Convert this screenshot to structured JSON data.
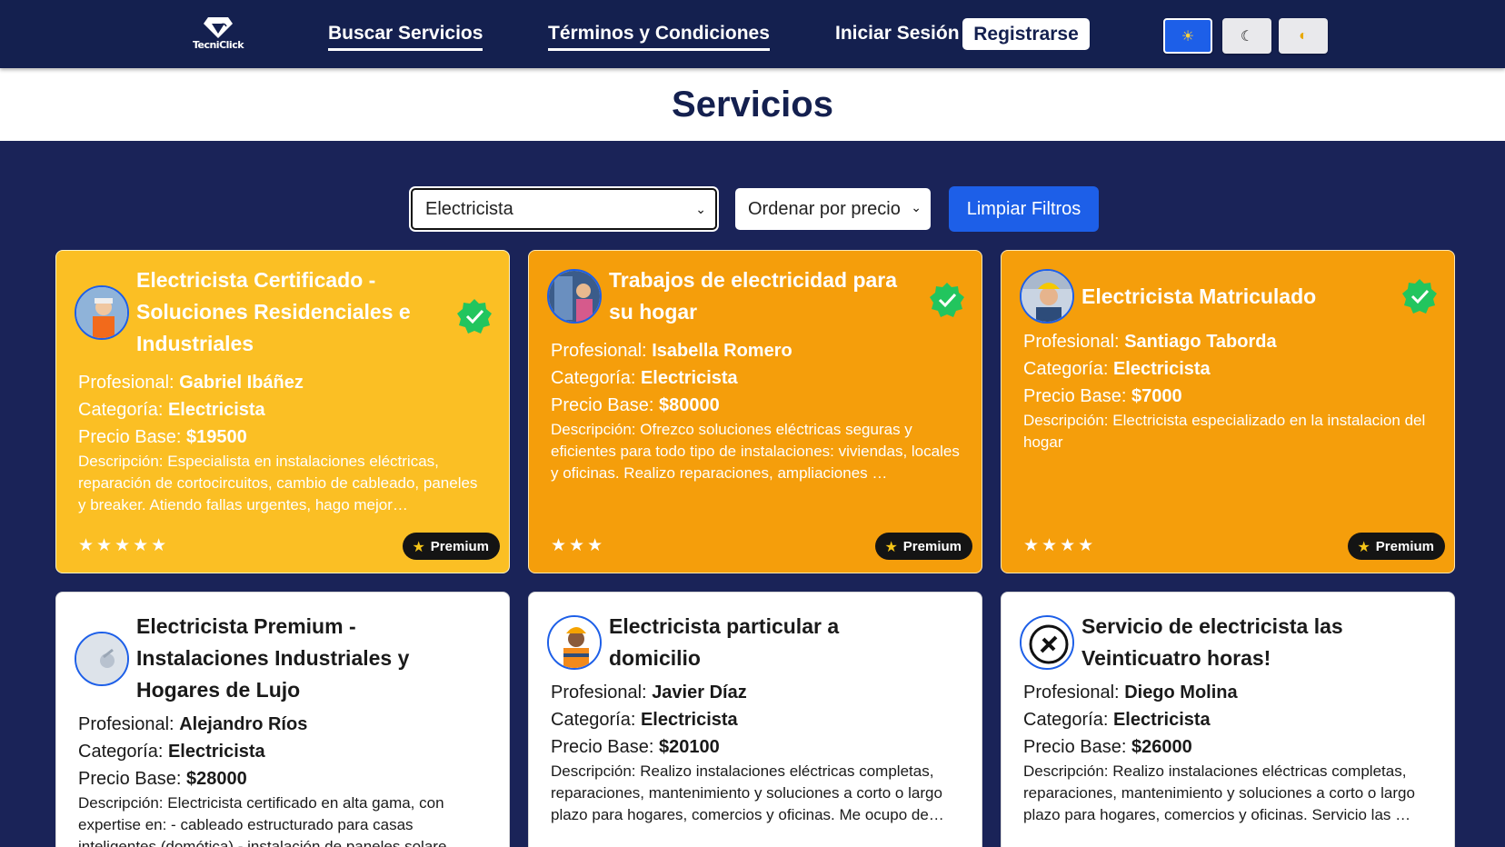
{
  "header": {
    "logo_text": "TecniClick",
    "nav": [
      {
        "label": "Buscar Servicios"
      },
      {
        "label": "Términos y Condiciones"
      }
    ],
    "login_label": "Iniciar Sesión",
    "register_label": "Registrarse",
    "theme_buttons": [
      {
        "icon": "sun-icon",
        "glyph": "☀",
        "active": true
      },
      {
        "icon": "moon-icon",
        "glyph": "☾",
        "active": false
      },
      {
        "icon": "moon-half-icon",
        "glyph": "◐",
        "active": false
      }
    ]
  },
  "page": {
    "title": "Servicios"
  },
  "filters": {
    "category_selected": "Electricista",
    "order_selected": "Ordenar por precio",
    "clear_label": "Limpiar Filtros"
  },
  "labels": {
    "professional": "Profesional:",
    "category": "Categoría:",
    "price": "Precio Base:",
    "description": "Descripción:",
    "premium": "Premium"
  },
  "colors": {
    "nav_bg": "#14204f",
    "body_bg": "#1a2358",
    "accent": "#1d5fe8",
    "premium_yellow": "#fbbf24",
    "premium_orange": "#f59e0b",
    "verified_green": "#22c55e"
  },
  "cards": [
    {
      "title": "Electricista Certificado - Soluciones Residenciales e Industriales",
      "professional": "Gabriel Ibáñez",
      "category": "Electricista",
      "price": "$19500",
      "description": "Especialista en instalaciones eléctricas, reparación de cortocircuitos, cambio de cableado, paneles y breaker. Atiendo fallas urgentes, hago mejor…",
      "rating": 5,
      "stars": "★★★★★",
      "premium": true,
      "verified": true
    },
    {
      "title": "Trabajos de electricidad para su hogar",
      "professional": "Isabella Romero",
      "category": "Electricista",
      "price": "$80000",
      "description": "Ofrezco soluciones eléctricas seguras y eficientes para todo tipo de instalaciones: viviendas, locales y oficinas. Realizo reparaciones, ampliaciones …",
      "rating": 3,
      "stars": "★★★",
      "premium": true,
      "verified": true
    },
    {
      "title": "Electricista Matriculado",
      "professional": "Santiago Taborda",
      "category": "Electricista",
      "price": "$7000",
      "description": "Electricista especializado en la instalacion del hogar",
      "rating": 4,
      "stars": "★★★★",
      "premium": true,
      "verified": true
    },
    {
      "title": "Electricista Premium - Instalaciones Industriales y Hogares de Lujo",
      "professional": "Alejandro Ríos",
      "category": "Electricista",
      "price": "$28000",
      "description": "Electricista certificado en alta gama, con expertise en: - cableado estructurado para casas inteligentes (domótica) - instalación de paneles solare…",
      "premium": false,
      "verified": false
    },
    {
      "title": "Electricista particular a domicilio",
      "professional": "Javier Díaz",
      "category": "Electricista",
      "price": "$20100",
      "description": "Realizo instalaciones eléctricas completas, reparaciones, mantenimiento y soluciones a corto o largo plazo para hogares, comercios y oficinas. Me ocupo de…",
      "premium": false,
      "verified": false
    },
    {
      "title": "Servicio de electricista las Veinticuatro horas!",
      "professional": "Diego Molina",
      "category": "Electricista",
      "price": "$26000",
      "description": "Realizo instalaciones eléctricas completas, reparaciones, mantenimiento y soluciones a corto o largo plazo para hogares, comercios y oficinas. Servicio las …",
      "premium": false,
      "verified": false
    }
  ]
}
